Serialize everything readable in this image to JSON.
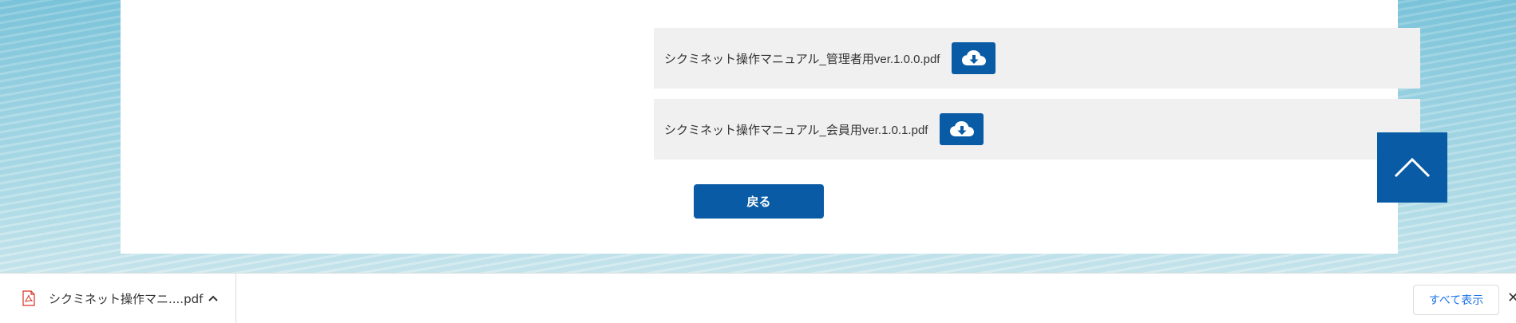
{
  "files": [
    {
      "name": "シクミネット操作マニュアル_管理者用ver.1.0.0.pdf",
      "icon": "cloud-download-icon"
    },
    {
      "name": "シクミネット操作マニュアル_会員用ver.1.0.1.pdf",
      "icon": "cloud-download-icon"
    }
  ],
  "back_button": {
    "label": "戻る"
  },
  "scroll_top": {
    "icon": "chevron-up-icon"
  },
  "download_bar": {
    "item_name": "シクミネット操作マニ....pdf",
    "show_all_label": "すべて表示",
    "close_label": "✕"
  },
  "colors": {
    "accent": "#0a5ba5",
    "row_bg": "#f0f0f0",
    "link": "#1a73e8"
  }
}
